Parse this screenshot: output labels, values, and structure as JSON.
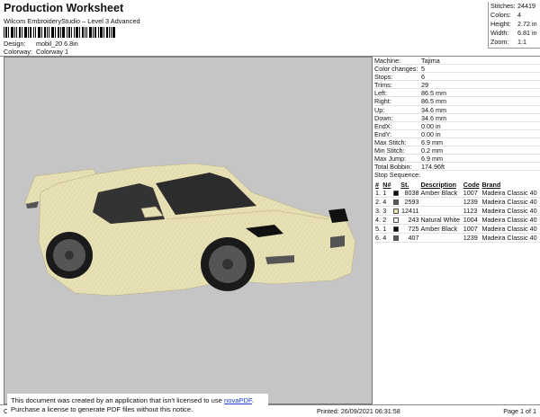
{
  "header": {
    "title": "Production Worksheet",
    "subtitle": "Wilcom EmbroideryStudio – Level 3 Advanced",
    "design_label": "Design:",
    "design_value": "mobil_20 6.8in",
    "colorway_label": "Colorway:",
    "colorway_value": "Colorway 1"
  },
  "stats": [
    {
      "label": "Stitches:",
      "value": "24419"
    },
    {
      "label": "Colors:",
      "value": "4"
    },
    {
      "label": "Height:",
      "value": "2.72 in"
    },
    {
      "label": "Width:",
      "value": "6.81 in"
    },
    {
      "label": "Zoom:",
      "value": "1:1"
    }
  ],
  "machine_info": [
    {
      "label": "Machine:",
      "value": "Tajima"
    },
    {
      "label": "Color changes:",
      "value": "5"
    },
    {
      "label": "Stops:",
      "value": "6"
    },
    {
      "label": "Trims:",
      "value": "29"
    },
    {
      "label": "Left:",
      "value": "86.5 mm"
    },
    {
      "label": "Right:",
      "value": "86.5 mm"
    },
    {
      "label": "Up:",
      "value": "34.6 mm"
    },
    {
      "label": "Down:",
      "value": "34.6 mm"
    },
    {
      "label": "EndX:",
      "value": "0.00 in"
    },
    {
      "label": "EndY:",
      "value": "0.00 in"
    },
    {
      "label": "Max Stitch:",
      "value": "6.9 mm"
    },
    {
      "label": "Min Stitch:",
      "value": "0.2 mm"
    },
    {
      "label": "Max Jump:",
      "value": "6.9 mm"
    },
    {
      "label": "Total Bobbin:",
      "value": "174.96ft"
    }
  ],
  "stop_sequence": {
    "title": "Stop Sequence:",
    "headers": [
      "#",
      "N#",
      "",
      "St.",
      "Description",
      "Code",
      "Brand"
    ],
    "rows": [
      {
        "num": "1.",
        "n": "1",
        "swatch": "#0b0b0b",
        "st": "8038",
        "desc": "Amber Black",
        "code": "1007",
        "brand": "Madeira Classic 40"
      },
      {
        "num": "2.",
        "n": "4",
        "swatch": "#555555",
        "st": "2593",
        "desc": "",
        "code": "1239",
        "brand": "Madeira Classic 40"
      },
      {
        "num": "3.",
        "n": "3",
        "swatch": "#e9e1b6",
        "st": "12411",
        "desc": "",
        "code": "1123",
        "brand": "Madeira Classic 40"
      },
      {
        "num": "4.",
        "n": "2",
        "swatch": "#f2f2f2",
        "st": "243",
        "desc": "Natural White",
        "code": "1004",
        "brand": "Madeira Classic 40"
      },
      {
        "num": "5.",
        "n": "1",
        "swatch": "#0b0b0b",
        "st": "725",
        "desc": "Amber Black",
        "code": "1007",
        "brand": "Madeira Classic 40"
      },
      {
        "num": "6.",
        "n": "4",
        "swatch": "#555555",
        "st": "407",
        "desc": "",
        "code": "1239",
        "brand": "Madeira Classic 40"
      }
    ]
  },
  "footer": {
    "created": "Cr",
    "printed": "Printed: 26/09/2021 06:31:58",
    "page": "Page 1 of 1"
  },
  "notice": {
    "line1_prefix": "This document was created by an application that isn't licensed to use ",
    "link": "novaPDF",
    "line1_suffix": ".",
    "line2": "Purchase a license to generate PDF files without this notice."
  },
  "colors": {
    "canvas_bg": "#c5c5c5",
    "car_body": "#e9e1b6",
    "glass": "#303030",
    "wheel": "#555555",
    "tire": "#1a1a1a"
  }
}
